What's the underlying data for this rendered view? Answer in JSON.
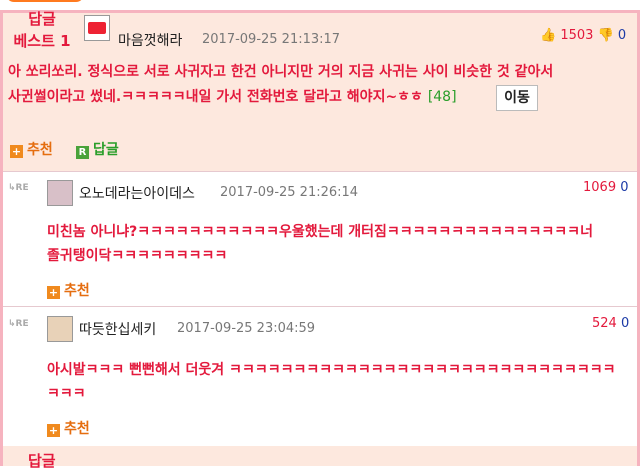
{
  "best": {
    "label_line1": "답글",
    "label_line2": "베스트 1",
    "nickname": "마음껏해라",
    "date": "2017-09-25 21:13:17",
    "up_count": "1503",
    "down_count": "0",
    "text": "아 쏘리쏘리. 정식으로 서로 사귀자고 한건 아니지만 거의 지금 사귀는 사이 비슷한 것 같아서 사귄썰이라고 썼네.ㅋㅋㅋㅋㅋ내일 가서 전화번호 달라고 해야지~ㅎㅎ",
    "reply_count": "[48]",
    "move_label": "이동",
    "recommend_label": "추천",
    "reply_label": "답글"
  },
  "comments": [
    {
      "re_label": "RE",
      "nickname": "오노데라는아이데스",
      "date": "2017-09-25 21:26:14",
      "score": "1069",
      "down": "0",
      "text_line1": "미친놈 아니냐?ㅋㅋㅋㅋㅋㅋㅋㅋㅋㅋㅋ우울했는데 개터짐ㅋㅋㅋㅋㅋㅋㅋㅋㅋㅋㅋㅋㅋㅋㅋ너",
      "text_line2": "졸귀탱이닥ㅋㅋㅋㅋㅋㅋㅋㅋㅋ",
      "recommend_label": "추천"
    },
    {
      "re_label": "RE",
      "nickname": "따듯한십세키",
      "date": "2017-09-25 23:04:59",
      "score": "524",
      "down": "0",
      "text_line1": "아시발ㅋㅋㅋ 뻔뻔해서 더웃겨 ㅋㅋㅋㅋㅋㅋㅋㅋㅋㅋㅋㅋㅋㅋㅋㅋㅋㅋㅋㅋㅋㅋㅋㅋㅋㅋㅋㅋㅋㅋ",
      "text_line2": "ㅋㅋㅋ",
      "recommend_label": "추천"
    }
  ],
  "next_best": {
    "label_line1": "답글"
  },
  "colors": {
    "accent_red": "#e3193c",
    "accent_orange": "#f08a1e",
    "best_bg": "#fde8de",
    "border_pink": "#f6b3bf"
  }
}
